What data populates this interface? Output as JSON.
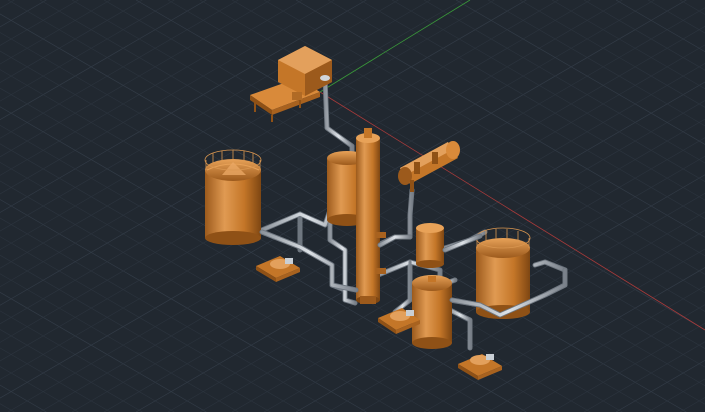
{
  "viewport": {
    "background": "#212830",
    "grid_minor_color": "#2b333d",
    "grid_major_color": "#323b46",
    "x_axis_color": "#a83a3a",
    "y_axis_color": "#3a9a3a"
  },
  "model": {
    "material_color": "#c97a2b",
    "material_shadow": "#8f5116",
    "material_highlight": "#e8a258",
    "pipe_color": "#b9c0c8",
    "pipe_shadow": "#6f7780"
  }
}
